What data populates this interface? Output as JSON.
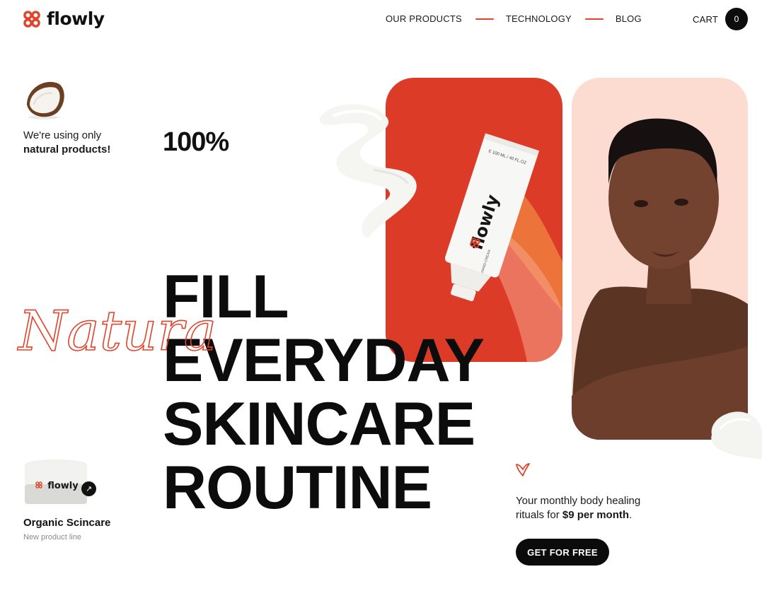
{
  "brand": {
    "name": "flowly",
    "accent": "#e2432b",
    "dark": "#0d0d0d",
    "peach": "#fcdcd0"
  },
  "nav": {
    "items": [
      "OUR PRODUCTS",
      "TECHNOLOGY",
      "BLOG"
    ]
  },
  "cart": {
    "label": "CART",
    "count": "0"
  },
  "intro": {
    "line1": "We're using only",
    "line2": "natural products!",
    "stat": "100%"
  },
  "hero": {
    "script_word": "Natural",
    "lines": [
      "FILL",
      "EVERYDAY",
      "SKINCARE",
      "ROUTINE"
    ],
    "tube_brand": "flowly",
    "tube_volume": "E 100 ML / 40 FL.OZ",
    "tube_type": "HAND CREAM"
  },
  "product": {
    "jar_brand": "flowly",
    "name": "Organic Scincare",
    "subtitle": "New product line"
  },
  "offer": {
    "text_before": "Your monthly body healing",
    "text_mid": "rituals for ",
    "price": "$9 per month",
    "text_after": "."
  },
  "cta": {
    "label": "GET FOR FREE"
  },
  "icons": {
    "logo": "flowly-logo-icon",
    "heart": "heart-icon",
    "arrow": "arrow-up-right-icon",
    "coconut": "coconut-image"
  }
}
